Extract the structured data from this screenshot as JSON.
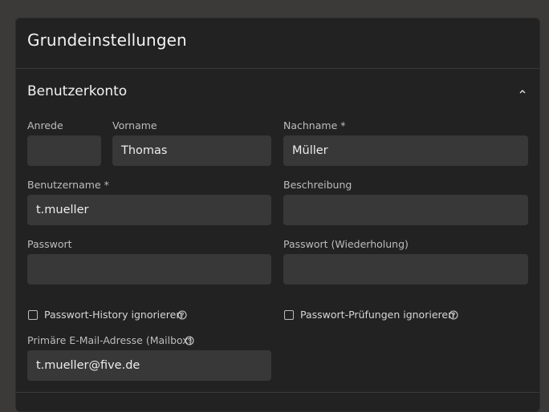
{
  "panel": {
    "title": "Grundeinstellungen"
  },
  "section": {
    "title": "Benutzerkonto",
    "collapse_icon": "chevron-up-icon"
  },
  "fields": {
    "anrede": {
      "label": "Anrede",
      "value": ""
    },
    "vorname": {
      "label": "Vorname",
      "value": "Thomas"
    },
    "nachname": {
      "label": "Nachname *",
      "value": "Müller"
    },
    "benutzername": {
      "label": "Benutzername *",
      "value": "t.mueller"
    },
    "beschreibung": {
      "label": "Beschreibung",
      "value": ""
    },
    "passwort": {
      "label": "Passwort",
      "value": ""
    },
    "passwort_wdh": {
      "label": "Passwort (Wiederholung)",
      "value": ""
    },
    "email": {
      "label": "Primäre E-Mail-Adresse (Mailbox)",
      "value": "t.mueller@five.de",
      "help_icon": "help-circle-icon"
    }
  },
  "checkboxes": {
    "history": {
      "label": "Passwort-History ignorieren",
      "checked": false,
      "help_icon": "help-circle-icon"
    },
    "pruefungen": {
      "label": "Passwort-Prüfungen ignorieren",
      "checked": false,
      "help_icon": "help-circle-icon"
    }
  }
}
